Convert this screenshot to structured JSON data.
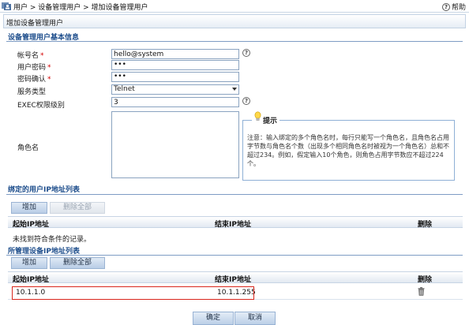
{
  "breadcrumb": {
    "text": "用户 > 设备管理用户 > 增加设备管理用户"
  },
  "help": {
    "label": "帮助"
  },
  "panel": {
    "title": "增加设备管理用户"
  },
  "basic": {
    "section_title": "设备管理用户基本信息",
    "account": {
      "label": "帐号名",
      "value": "hello@system"
    },
    "password": {
      "label": "用户密码",
      "value": "•••"
    },
    "confirm": {
      "label": "密码确认",
      "value": "•••"
    },
    "service": {
      "label": "服务类型",
      "value": "Telnet"
    },
    "exec_level": {
      "label": "EXEC权限级别",
      "value": "3"
    },
    "role": {
      "label": "角色名"
    },
    "required_mark": "*"
  },
  "tip": {
    "title": "提示",
    "text": "注意：输入绑定的多个角色名时，每行只能写一个角色名，且角色名占用字节数与角色名个数（出现多个相同角色名时被视为一个角色名）总和不超过234。例如，假定输入10个角色，则角色占用字节数应不超过224个。"
  },
  "bound_ip": {
    "section_title": "绑定的用户IP地址列表",
    "add_label": "增加",
    "delete_all_label": "删除全部",
    "col_start": "起始IP地址",
    "col_end": "结束IP地址",
    "col_delete": "删除",
    "empty_text": "未找到符合条件的记录。"
  },
  "managed_ip": {
    "section_title": "所管理设备IP地址列表",
    "add_label": "增加",
    "delete_all_label": "删除全部",
    "col_start": "起始IP地址",
    "col_end": "结束IP地址",
    "col_delete": "删除",
    "rows": [
      {
        "start": "10.1.1.0",
        "end": "10.1.1.255"
      }
    ]
  },
  "footer": {
    "confirm_label": "确定",
    "cancel_label": "取消"
  }
}
